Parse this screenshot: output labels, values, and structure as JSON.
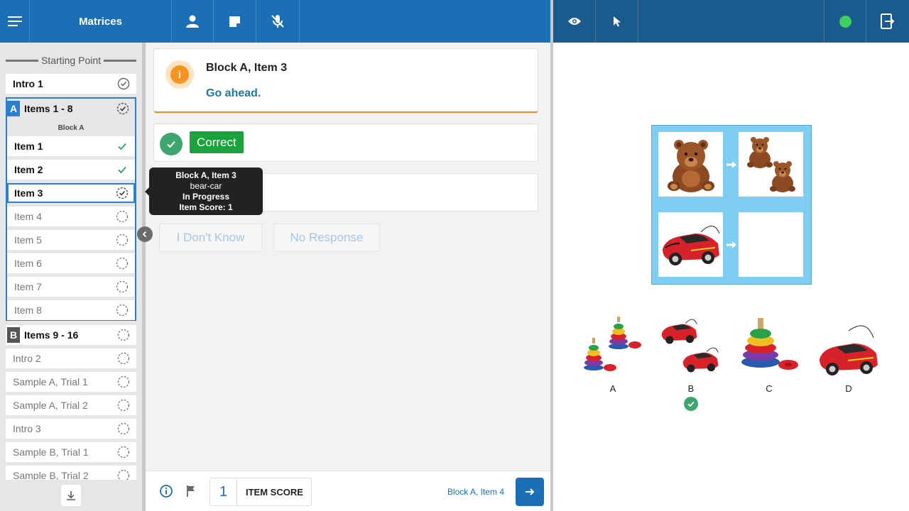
{
  "topbar": {
    "title": "Matrices",
    "icons": [
      "menu-icon",
      "person-icon",
      "note-icon",
      "mic-off-icon",
      "eye-icon",
      "pointer-icon",
      "status-dot",
      "exit-icon"
    ],
    "status_color": "#3fcf5c"
  },
  "sidebar": {
    "starting_point": "Starting Point",
    "intro1": "Intro 1",
    "block_a": {
      "letter": "A",
      "label": "Items 1 - 8",
      "sub": "Block A",
      "color": "#2a7fd0"
    },
    "items": [
      {
        "label": "Item 1",
        "status": "done"
      },
      {
        "label": "Item 2",
        "status": "done"
      },
      {
        "label": "Item 3",
        "status": "in-progress"
      },
      {
        "label": "Item 4",
        "status": "pending"
      },
      {
        "label": "Item 5",
        "status": "pending"
      },
      {
        "label": "Item 6",
        "status": "pending"
      },
      {
        "label": "Item 7",
        "status": "pending"
      },
      {
        "label": "Item 8",
        "status": "pending"
      }
    ],
    "block_b": {
      "letter": "B",
      "label": "Items 9 - 16",
      "color": "#555555"
    },
    "others": [
      "Intro 2",
      "Sample A, Trial 1",
      "Sample A, Trial 2",
      "Intro 3",
      "Sample B, Trial 1",
      "Sample B, Trial 2"
    ]
  },
  "tooltip": {
    "title": "Block A, Item 3",
    "name": "bear-car",
    "state": "In Progress",
    "score": "Item Score: 1"
  },
  "center": {
    "info_title": "Block A, Item 3",
    "info_msg": "Go ahead.",
    "correct_label": "Correct",
    "dont_know": "I Don't Know",
    "no_response": "No Response"
  },
  "bottom": {
    "score": "1",
    "score_label": "ITEM SCORE",
    "next_label": "Block A, Item 4"
  },
  "stimulus": {
    "choices": [
      "A",
      "B",
      "C",
      "D"
    ],
    "selected": "B"
  }
}
